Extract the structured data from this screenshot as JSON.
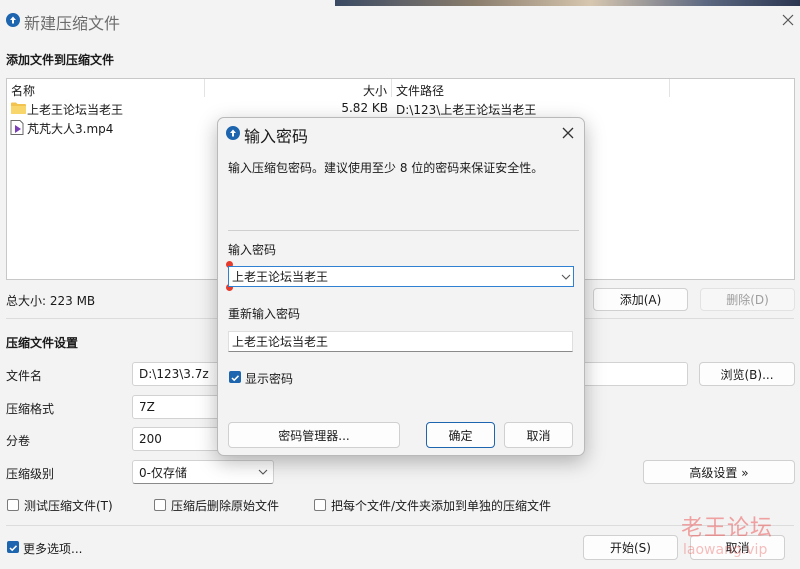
{
  "window": {
    "title": "新建压缩文件"
  },
  "add_files": {
    "header": "添加文件到压缩文件",
    "columns": [
      "名称",
      "大小",
      "文件路径"
    ],
    "files": [
      {
        "name": "上老王论坛当老王",
        "size": "5.82 KB",
        "path": "D:\\123\\上老王论坛当老王",
        "icon": "folder-icon"
      },
      {
        "name": "芃芃大人3.mp4",
        "size": "",
        "path": "",
        "icon": "video-file-icon"
      }
    ],
    "total_size": "总大小: 223 MB",
    "add_button": "添加(A)",
    "delete_button": "删除(D)"
  },
  "settings": {
    "header": "压缩文件设置",
    "filename_label": "文件名",
    "filename_value": "D:\\123\\3.7z",
    "browse_button": "浏览(B)...",
    "format_label": "压缩格式",
    "format_value": "7Z",
    "split_label": "分卷",
    "split_value": "200",
    "level_label": "压缩级别",
    "level_value": "0-仅存储",
    "advanced_button": "高级设置 »",
    "test_checkbox": "测试压缩文件(T)",
    "delete_after_checkbox": "压缩后删除原始文件",
    "separate_checkbox": "把每个文件/文件夹添加到单独的压缩文件"
  },
  "footer": {
    "more_options": "更多选项...",
    "start_button": "开始(S)",
    "cancel_button": "取消"
  },
  "password_dialog": {
    "title": "输入密码",
    "description": "输入压缩包密码。建议使用至少 8 位的密码来保证安全性。",
    "password_label": "输入密码",
    "password_value": "上老王论坛当老王",
    "reenter_label": "重新输入密码",
    "reenter_value": "上老王论坛当老王",
    "show_password": "显示密码",
    "manager_button": "密码管理器...",
    "ok_button": "确定",
    "cancel_button": "取消"
  },
  "watermark": {
    "title": "老王论坛",
    "url": "laowang.vip"
  },
  "colors": {
    "accent": "#1d65ae",
    "focus_border": "#2f7fd3",
    "marker": "#e53b2c",
    "watermark": "#ec5d5d"
  }
}
